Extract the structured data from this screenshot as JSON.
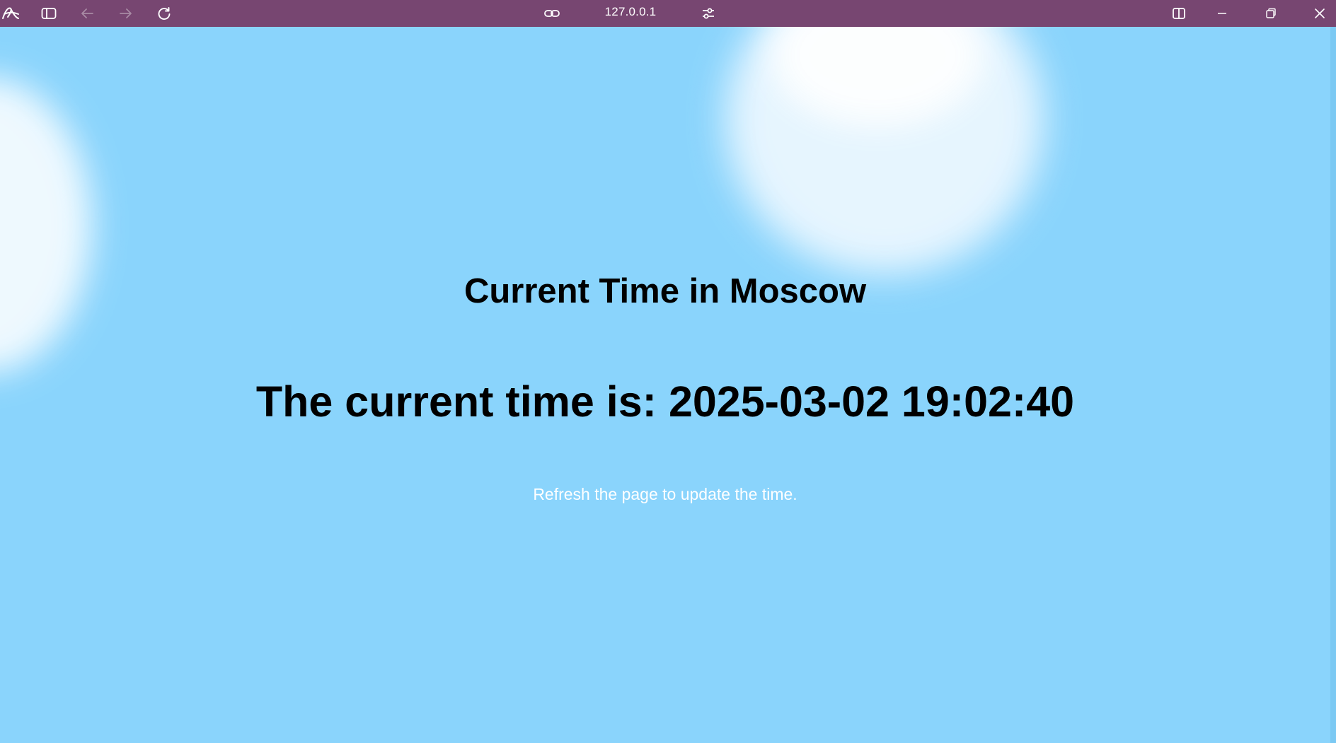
{
  "browser": {
    "address": "127.0.0.1",
    "accent_color": "#774671",
    "icons": {
      "app": "arc-logo-icon",
      "sidebar": "sidebar-toggle-icon",
      "back": "arrow-left-icon",
      "forward": "arrow-right-icon",
      "reload": "reload-icon",
      "link": "link-icon",
      "settings": "sliders-icon",
      "split": "split-view-icon",
      "minimize": "minimize-icon",
      "restore": "restore-icon",
      "close": "close-icon"
    }
  },
  "page": {
    "background_color": "#8ad4fc",
    "heading": "Current Time in Moscow",
    "time_label": "The current time is:",
    "time_value": "2025-03-02 19:02:40",
    "hint": "Refresh the page to update the time."
  }
}
